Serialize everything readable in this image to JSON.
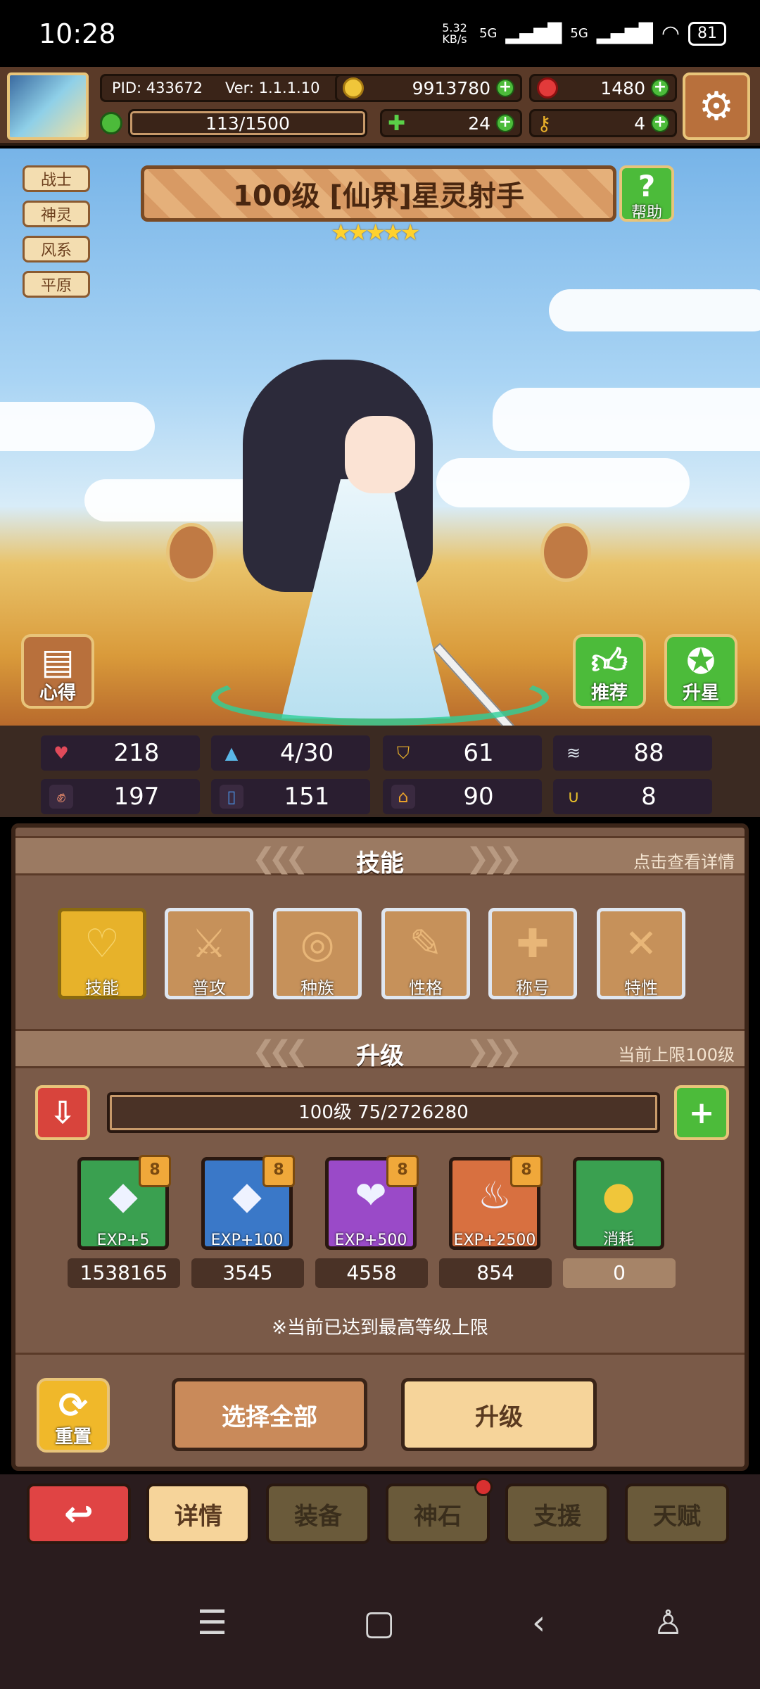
{
  "status": {
    "time": "10:28",
    "net_speed": "5.32 KB/s",
    "signal1": "5G",
    "signal2": "5G",
    "battery": "81"
  },
  "top": {
    "pid": "PID: 433672",
    "ver": "Ver: 1.1.1.10",
    "gold": "9913780",
    "gems": "1480",
    "stamina": "113/1500",
    "clover": "24",
    "keys": "4"
  },
  "hero": {
    "tags": [
      "战士",
      "神灵",
      "风系",
      "平原"
    ],
    "title": "100级 [仙界]星灵射手",
    "stars": "★★★★★",
    "help": "帮助",
    "left_btn": "心得",
    "recommend": "推荐",
    "star_up": "升星"
  },
  "stats": [
    {
      "icon": "heart-icon",
      "value": "218",
      "color": "#e04a5a"
    },
    {
      "icon": "water-icon",
      "value": "4/30",
      "color": "#5ab8e8"
    },
    {
      "icon": "shield-icon",
      "value": "61",
      "color": "#e8b02a"
    },
    {
      "icon": "wing-icon",
      "value": "88",
      "color": "#d8e0e8"
    },
    {
      "icon": "fist-icon",
      "value": "197",
      "color": "#e88a6a"
    },
    {
      "icon": "book-icon",
      "value": "151",
      "color": "#4a8ad8"
    },
    {
      "icon": "boot-icon",
      "value": "90",
      "color": "#e8a02a"
    },
    {
      "icon": "horseshoe-icon",
      "value": "8",
      "color": "#e8c02a"
    }
  ],
  "skills": {
    "header": "技能",
    "hint": "点击查看详情",
    "items": [
      "技能",
      "普攻",
      "种族",
      "性格",
      "称号",
      "特性"
    ]
  },
  "upgrade": {
    "header": "升级",
    "hint": "当前上限100级",
    "bar": "100级  75/2726280",
    "items": [
      {
        "label": "EXP+5",
        "count": "1538165",
        "badge": "8"
      },
      {
        "label": "EXP+100",
        "count": "3545",
        "badge": "8"
      },
      {
        "label": "EXP+500",
        "count": "4558",
        "badge": "8"
      },
      {
        "label": "EXP+2500",
        "count": "854",
        "badge": "8"
      },
      {
        "label": "消耗",
        "count": "0",
        "badge": ""
      }
    ],
    "note": "※当前已达到最高等级上限",
    "reset": "重置",
    "select_all": "选择全部",
    "upgrade_btn": "升级"
  },
  "nav": {
    "back": "↩",
    "tabs": [
      "详情",
      "装备",
      "神石",
      "支援",
      "天赋"
    ]
  }
}
